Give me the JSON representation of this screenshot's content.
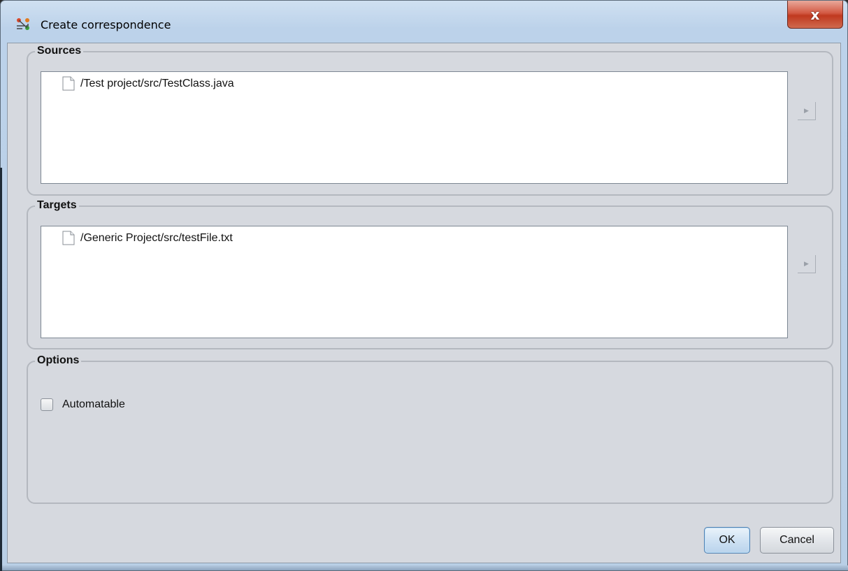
{
  "window": {
    "title": "Create correspondence",
    "close_glyph": "x",
    "icon": "create-correspondence-app-icon"
  },
  "sources": {
    "title": "Sources",
    "items": [
      {
        "label": "/Test project/src/TestClass.java",
        "icon": "file-icon"
      }
    ]
  },
  "targets": {
    "title": "Targets",
    "items": [
      {
        "label": "/Generic Project/src/testFile.txt",
        "icon": "file-icon"
      }
    ]
  },
  "options": {
    "title": "Options",
    "automatable": {
      "label": "Automatable",
      "checked": false
    }
  },
  "buttons": {
    "ok": "OK",
    "cancel": "Cancel"
  },
  "colors": {
    "client_background": "#d6d9df",
    "titlebar": "#bcd2ea",
    "close_button": "#c0391f",
    "default_button": "#cfe2f3"
  }
}
